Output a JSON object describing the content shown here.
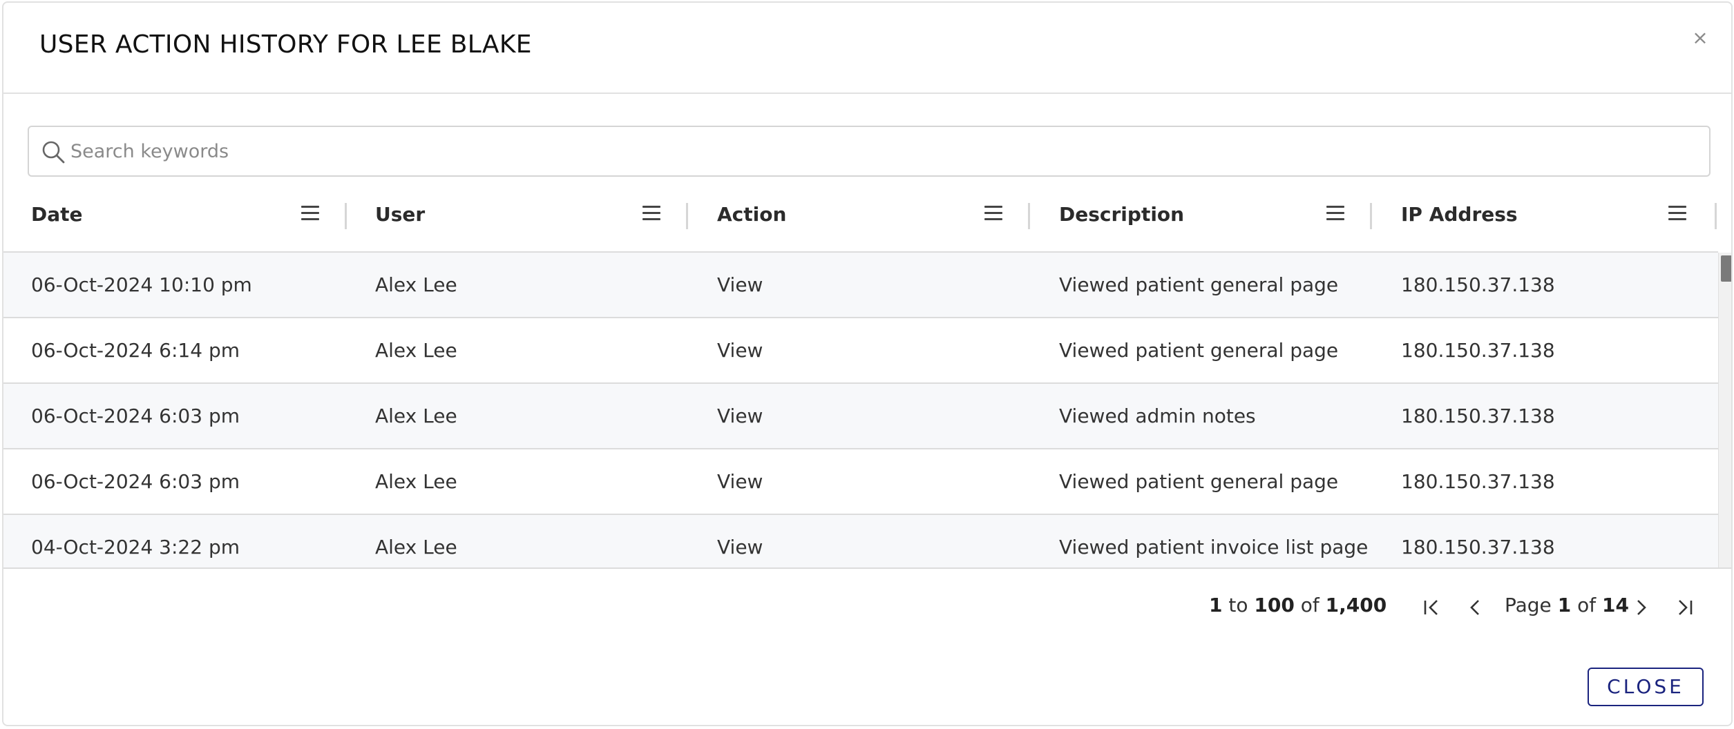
{
  "dialog": {
    "title": "USER ACTION HISTORY FOR LEE BLAKE",
    "close_icon": "×",
    "close_button": "CLOSE"
  },
  "search": {
    "placeholder": "Search keywords",
    "value": ""
  },
  "table": {
    "columns": [
      "Date",
      "User",
      "Action",
      "Description",
      "IP Address"
    ],
    "rows": [
      [
        "06-Oct-2024 10:10 pm",
        "Alex Lee",
        "View",
        "Viewed patient general page",
        "180.150.37.138"
      ],
      [
        "06-Oct-2024 6:14 pm",
        "Alex Lee",
        "View",
        "Viewed patient general page",
        "180.150.37.138"
      ],
      [
        "06-Oct-2024 6:03 pm",
        "Alex Lee",
        "View",
        "Viewed admin notes",
        "180.150.37.138"
      ],
      [
        "06-Oct-2024 6:03 pm",
        "Alex Lee",
        "View",
        "Viewed patient general page",
        "180.150.37.138"
      ],
      [
        "04-Oct-2024 3:22 pm",
        "Alex Lee",
        "View",
        "Viewed patient invoice list page",
        "180.150.37.138"
      ]
    ]
  },
  "pagination": {
    "from": "1",
    "to_word": "to",
    "to": "100",
    "of_word": "of",
    "total": "1,400",
    "page_word": "Page",
    "page": "1",
    "page_of_word": "of",
    "page_count": "14"
  },
  "colors": {
    "accent": "#1a237e",
    "border": "#e1e1e1",
    "row_alt": "#f7f8fa"
  },
  "icons": {
    "search": "search-icon",
    "column_menu": "menu-icon",
    "first": "first-page-icon",
    "prev": "previous-page-icon",
    "next": "next-page-icon",
    "last": "last-page-icon",
    "close": "close-icon"
  }
}
